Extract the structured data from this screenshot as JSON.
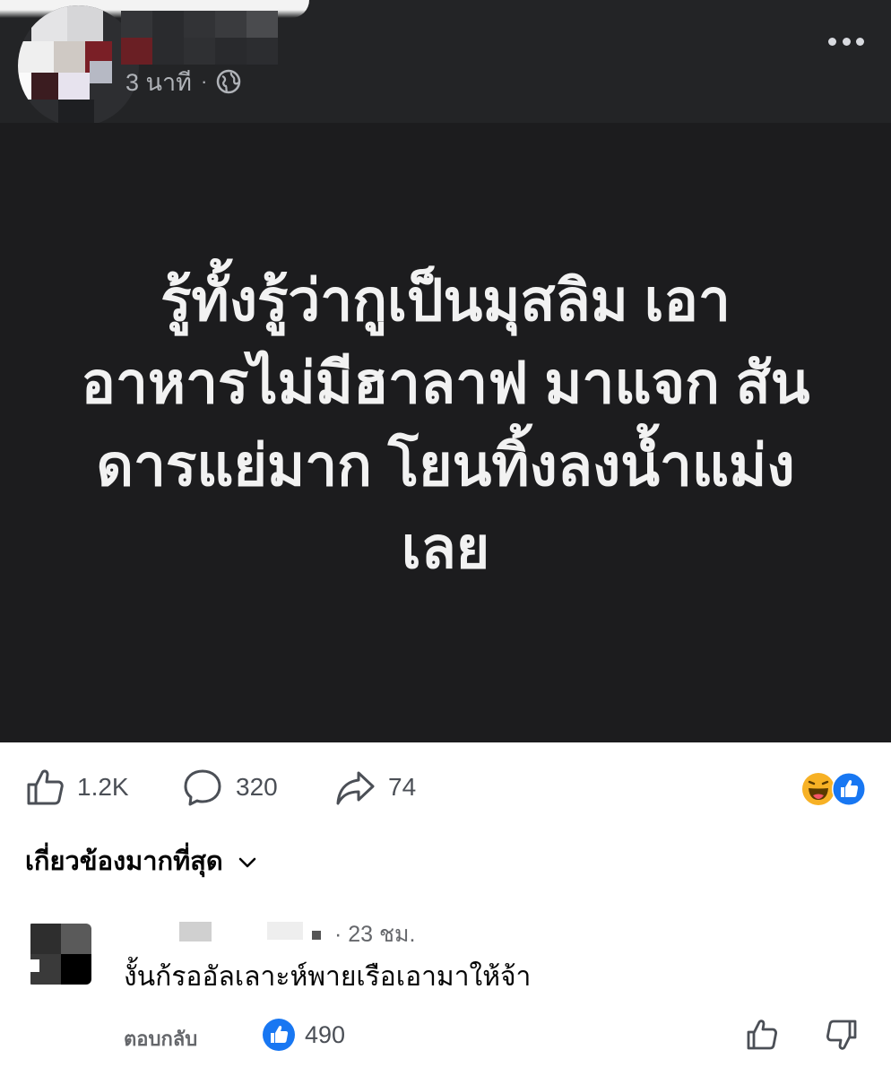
{
  "post": {
    "time": "3 นาที",
    "separator": "·",
    "text": "รู้ทั้งรู้ว่ากูเป็นมุสลิม เอา อาหารไม่มีฮาลาฟ มาแจก สัน ดารแย่มาก โยนทิ้งลงน้ำแม่ง เลย",
    "text_lines": [
      "รู้ทั้งรู้ว่ากูเป็นมุสลิม เอา",
      "อาหารไม่มีฮาลาฟ มาแจก สัน",
      "ดารแย่มาก โยนทิ้งลงน้ำแม่ง",
      "เลย"
    ],
    "background_color": "#1c1c1e"
  },
  "actions": {
    "likes": "1.2K",
    "comments": "320",
    "shares": "74",
    "reaction_icons": [
      "haha-icon",
      "like-icon"
    ]
  },
  "sort": {
    "label": "เกี่ยวข้องมากที่สุด"
  },
  "comment": {
    "time": "· 23 ชม.",
    "text": "งั้นก้รออัลเลาะห์พายเรือเอามาให้จ้า",
    "reply_label": "ตอบกลับ",
    "like_count": "490"
  },
  "colors": {
    "like_blue": "#1877f2",
    "haha_yellow": "#f7b125",
    "muted_text": "#65676b"
  }
}
